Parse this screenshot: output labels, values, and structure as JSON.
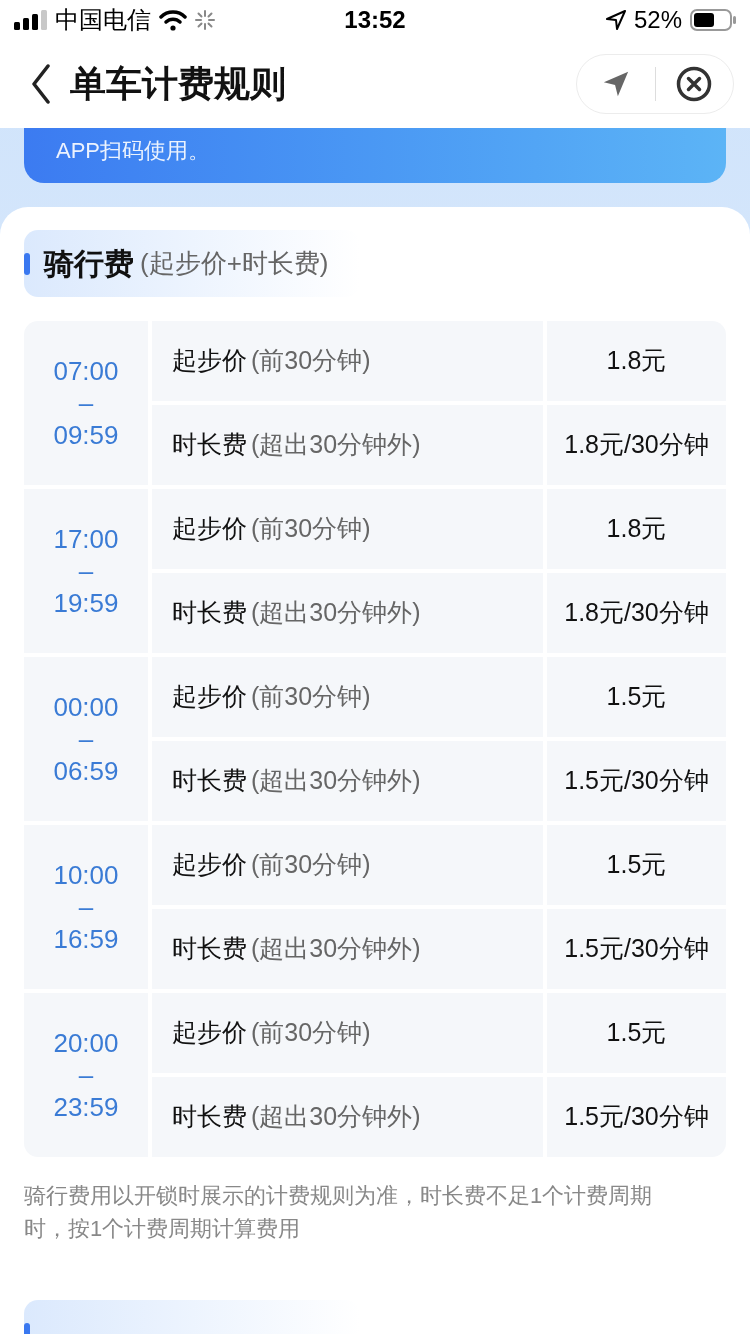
{
  "status_bar": {
    "carrier": "中国电信",
    "time": "13:52",
    "battery": "52%"
  },
  "header": {
    "title": "单车计费规则"
  },
  "banner": {
    "text": "APP扫码使用。"
  },
  "sections": [
    {
      "title": "骑行费",
      "subtitle": "(起步价+时长费)",
      "periods": [
        {
          "time": "07:00\n–\n09:59",
          "rows": [
            {
              "label": "起步价",
              "note": "(前30分钟)",
              "price": "1.8元"
            },
            {
              "label": "时长费",
              "note": "(超出30分钟外)",
              "price": "1.8元/30分钟"
            }
          ]
        },
        {
          "time": "17:00\n–\n19:59",
          "rows": [
            {
              "label": "起步价",
              "note": "(前30分钟)",
              "price": "1.8元"
            },
            {
              "label": "时长费",
              "note": "(超出30分钟外)",
              "price": "1.8元/30分钟"
            }
          ]
        },
        {
          "time": "00:00\n–\n06:59",
          "rows": [
            {
              "label": "起步价",
              "note": "(前30分钟)",
              "price": "1.5元"
            },
            {
              "label": "时长费",
              "note": "(超出30分钟外)",
              "price": "1.5元/30分钟"
            }
          ]
        },
        {
          "time": "10:00\n–\n16:59",
          "rows": [
            {
              "label": "起步价",
              "note": "(前30分钟)",
              "price": "1.5元"
            },
            {
              "label": "时长费",
              "note": "(超出30分钟外)",
              "price": "1.5元/30分钟"
            }
          ]
        },
        {
          "time": "20:00\n–\n23:59",
          "rows": [
            {
              "label": "起步价",
              "note": "(前30分钟)",
              "price": "1.5元"
            },
            {
              "label": "时长费",
              "note": "(超出30分钟外)",
              "price": "1.5元/30分钟"
            }
          ]
        }
      ],
      "note": "骑行费用以开锁时展示的计费规则为准，时长费不足1个计费周期时，按1个计费周期计算费用"
    }
  ]
}
